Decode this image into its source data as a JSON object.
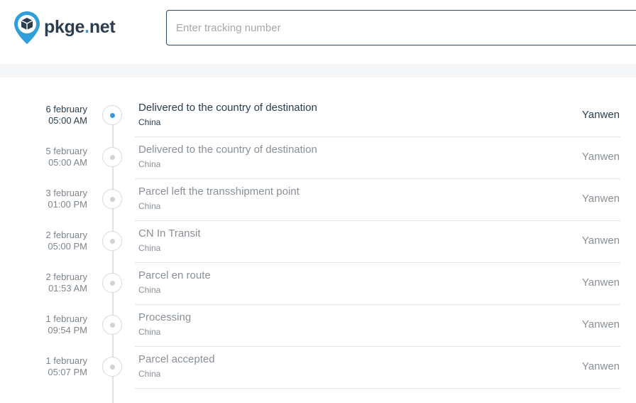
{
  "header": {
    "logo_text": "pkge",
    "logo_dot": ".",
    "logo_tld": "net",
    "search_placeholder": "Enter tracking number",
    "search_value": ""
  },
  "colors": {
    "brand_dark": "#2b3d4f",
    "brand_blue": "#2e9fd8",
    "active_dot": "#3a9ad9",
    "muted_text": "#8a9097"
  },
  "events": [
    {
      "date": "6 february",
      "time": "05:00 AM",
      "status": "Delivered to the country of destination",
      "location": "China",
      "carrier": "Yanwen",
      "current": true
    },
    {
      "date": "5 february",
      "time": "05:00 AM",
      "status": "Delivered to the country of destination",
      "location": "China",
      "carrier": "Yanwen",
      "current": false
    },
    {
      "date": "3 february",
      "time": "01:00 PM",
      "status": "Parcel left the transshipment point",
      "location": "China",
      "carrier": "Yanwen",
      "current": false
    },
    {
      "date": "2 february",
      "time": "05:00 PM",
      "status": "CN In Transit",
      "location": "China",
      "carrier": "Yanwen",
      "current": false
    },
    {
      "date": "2 february",
      "time": "01:53 AM",
      "status": "Parcel en route",
      "location": "China",
      "carrier": "Yanwen",
      "current": false
    },
    {
      "date": "1 february",
      "time": "09:54 PM",
      "status": "Processing",
      "location": "China",
      "carrier": "Yanwen",
      "current": false
    },
    {
      "date": "1 february",
      "time": "05:07 PM",
      "status": "Parcel accepted",
      "location": "China",
      "carrier": "Yanwen",
      "current": false
    }
  ]
}
